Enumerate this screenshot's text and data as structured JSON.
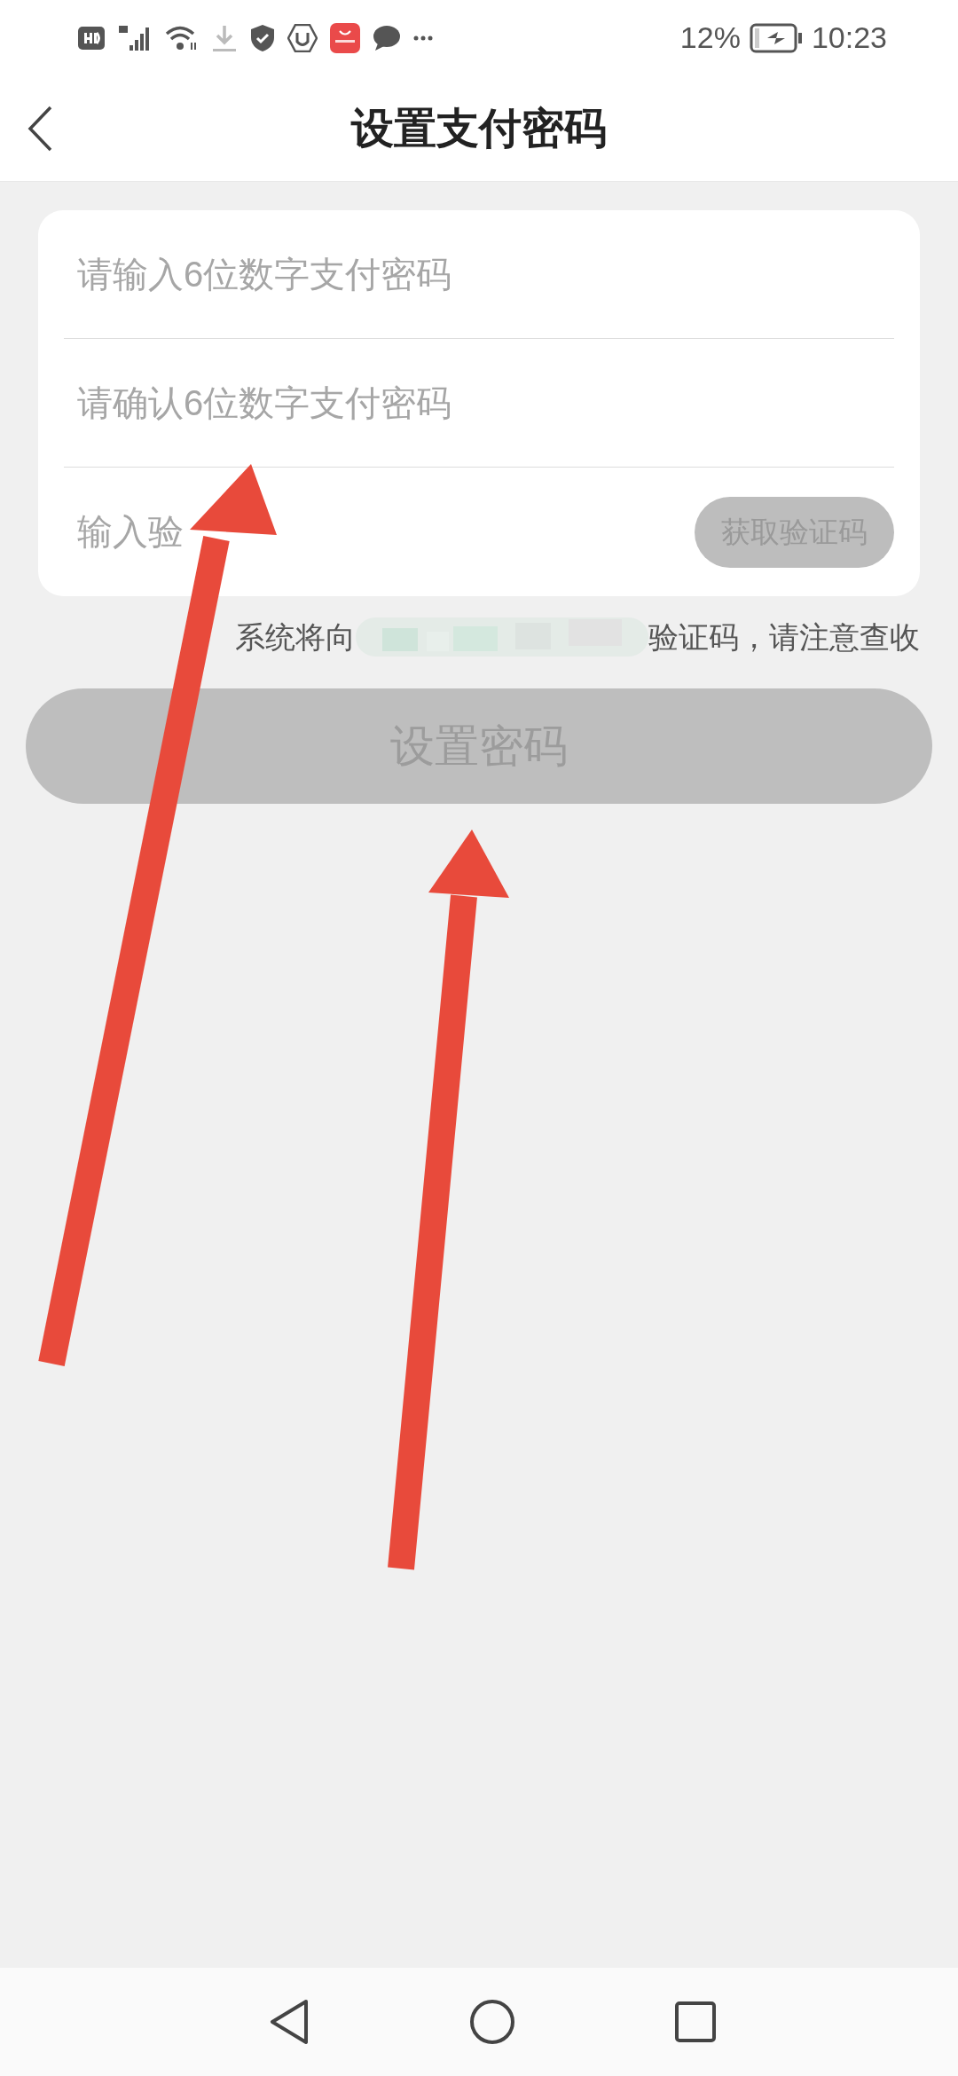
{
  "status_bar": {
    "battery": "12%",
    "time": "10:23"
  },
  "header": {
    "title": "设置支付密码"
  },
  "form": {
    "fields": [
      {
        "kind": "input",
        "placeholder": "请输入6位数字支付密码"
      },
      {
        "kind": "input",
        "placeholder": "请确认6位数字支付密码"
      },
      {
        "kind": "code",
        "placeholder": "输入验",
        "button": {
          "label": "获取验证码",
          "disabled": true
        }
      }
    ]
  },
  "notice": {
    "before": "系统将向",
    "after": "验证码，请注意查收"
  },
  "submit": {
    "label": "设置密码",
    "disabled": true
  }
}
